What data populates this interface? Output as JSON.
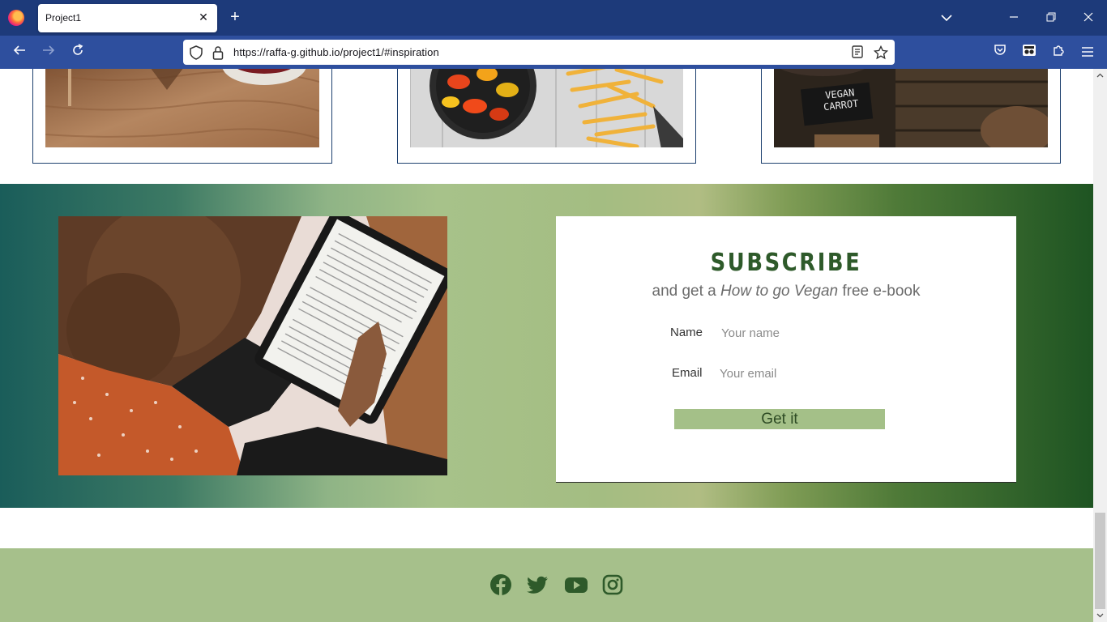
{
  "browser": {
    "tab_title": "Project1",
    "tab_close": "✕",
    "new_tab": "+",
    "url": "https://raffa-g.github.io/project1/#inspiration"
  },
  "subscribe": {
    "title": "SUBSCRIBE",
    "tagline_prefix": "and get a ",
    "tagline_emphasis": "How to go Vegan",
    "tagline_suffix": " free e-book",
    "name_label": "Name",
    "name_placeholder": "Your name",
    "email_label": "Email",
    "email_placeholder": "Your email",
    "submit_label": "Get it"
  },
  "inspiration_cards": [
    {
      "image": "wooden-table-with-bowl-photo"
    },
    {
      "image": "peppers-and-fries-photo"
    },
    {
      "image": "vegan-carrot-sign-photo",
      "sign_text": "VEGAN CARROT"
    }
  ],
  "footer": {
    "social_icons": [
      "facebook-icon",
      "twitter-icon",
      "youtube-icon",
      "instagram-icon"
    ]
  },
  "colors": {
    "chrome_tabbar": "#1d3a7a",
    "chrome_navbar": "#2e4f9e",
    "card_border": "#1c3f6e",
    "heading_green": "#2e5a2a",
    "button_green": "#a4c088",
    "footer_green": "#a6c08b",
    "icon_green": "#2e5a2a"
  }
}
